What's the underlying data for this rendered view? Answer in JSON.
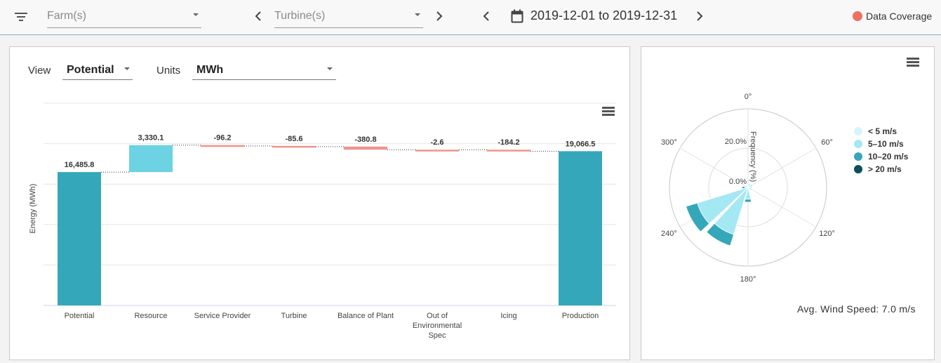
{
  "topbar": {
    "farm_placeholder": "Farm(s)",
    "turbine_placeholder": "Turbine(s)",
    "date_range": "2019-12-01 to 2019-12-31",
    "coverage_label": "Data Coverage",
    "coverage_color": "#f07060"
  },
  "waterfall": {
    "view_label": "View",
    "view_value": "Potential",
    "units_label": "Units",
    "units_value": "MWh",
    "ylabel": "Energy (MWh)"
  },
  "chart_data": [
    {
      "type": "bar",
      "subtype": "waterfall",
      "categories": [
        "Potential",
        "Resource",
        "Service Provider",
        "Turbine",
        "Balance of Plant",
        "Out of Environmental Spec",
        "Icing",
        "Production"
      ],
      "category_lines": [
        [
          "Potential"
        ],
        [
          "Resource"
        ],
        [
          "Service Provider"
        ],
        [
          "Turbine"
        ],
        [
          "Balance of Plant"
        ],
        [
          "Out of",
          "Environmental",
          "Spec"
        ],
        [
          "Icing"
        ],
        [
          "Production"
        ]
      ],
      "values": [
        16485.8,
        3330.1,
        -96.2,
        -85.6,
        -380.8,
        -2.6,
        -184.2,
        19066.5
      ],
      "labels": [
        "16,485.8",
        "3,330.1",
        "-96.2",
        "-85.6",
        "-380.8",
        "-2.6",
        "-184.2",
        "19,066.5"
      ],
      "kinds": [
        "total",
        "delta",
        "delta",
        "delta",
        "delta",
        "delta",
        "delta",
        "total"
      ],
      "colors": {
        "total": "#35a7ba",
        "gain": "#6dd2e2",
        "loss": "#f0938a"
      },
      "ylabel": "Energy (MWh)",
      "ylim": [
        0,
        25000
      ],
      "grid": true
    },
    {
      "type": "polar_bar",
      "subtype": "wind_rose",
      "angle_labels": [
        "0°",
        "60°",
        "120°",
        "180°",
        "240°",
        "300°"
      ],
      "radial_labels": [
        "0.0%",
        "20.0%"
      ],
      "radial_axis_label": "Frequency (%)",
      "rmax": 40,
      "legend": [
        "< 5 m/s",
        "5–10 m/s",
        "10–20 m/s",
        "> 20 m/s"
      ],
      "legend_position": "right",
      "colors": [
        "#d6f5fa",
        "#a4e8f3",
        "#35a7ba",
        "#0b4f5c"
      ],
      "directions": [
        {
          "dir": 270,
          "bands": [
            0,
            1.5,
            1.5,
            0
          ]
        },
        {
          "dir": 240,
          "bands": [
            0,
            27,
            6,
            0
          ]
        },
        {
          "dir": 210,
          "bands": [
            0,
            25,
            6,
            0
          ]
        },
        {
          "dir": 180,
          "bands": [
            0,
            6,
            1.5,
            0
          ]
        },
        {
          "dir": 60,
          "bands": [
            0,
            2.5,
            0,
            0
          ]
        },
        {
          "dir": 90,
          "bands": [
            0,
            2,
            0,
            0
          ]
        },
        {
          "dir": 120,
          "bands": [
            0,
            2,
            0,
            0
          ]
        },
        {
          "dir": 30,
          "bands": [
            0,
            2,
            0,
            0
          ]
        },
        {
          "dir": 330,
          "bands": [
            0,
            1.5,
            0,
            0
          ]
        },
        {
          "dir": 300,
          "bands": [
            0,
            1.5,
            0,
            0
          ]
        }
      ]
    }
  ],
  "windrose": {
    "avg_wind_speed": "Avg. Wind Speed: 7.0 m/s"
  }
}
